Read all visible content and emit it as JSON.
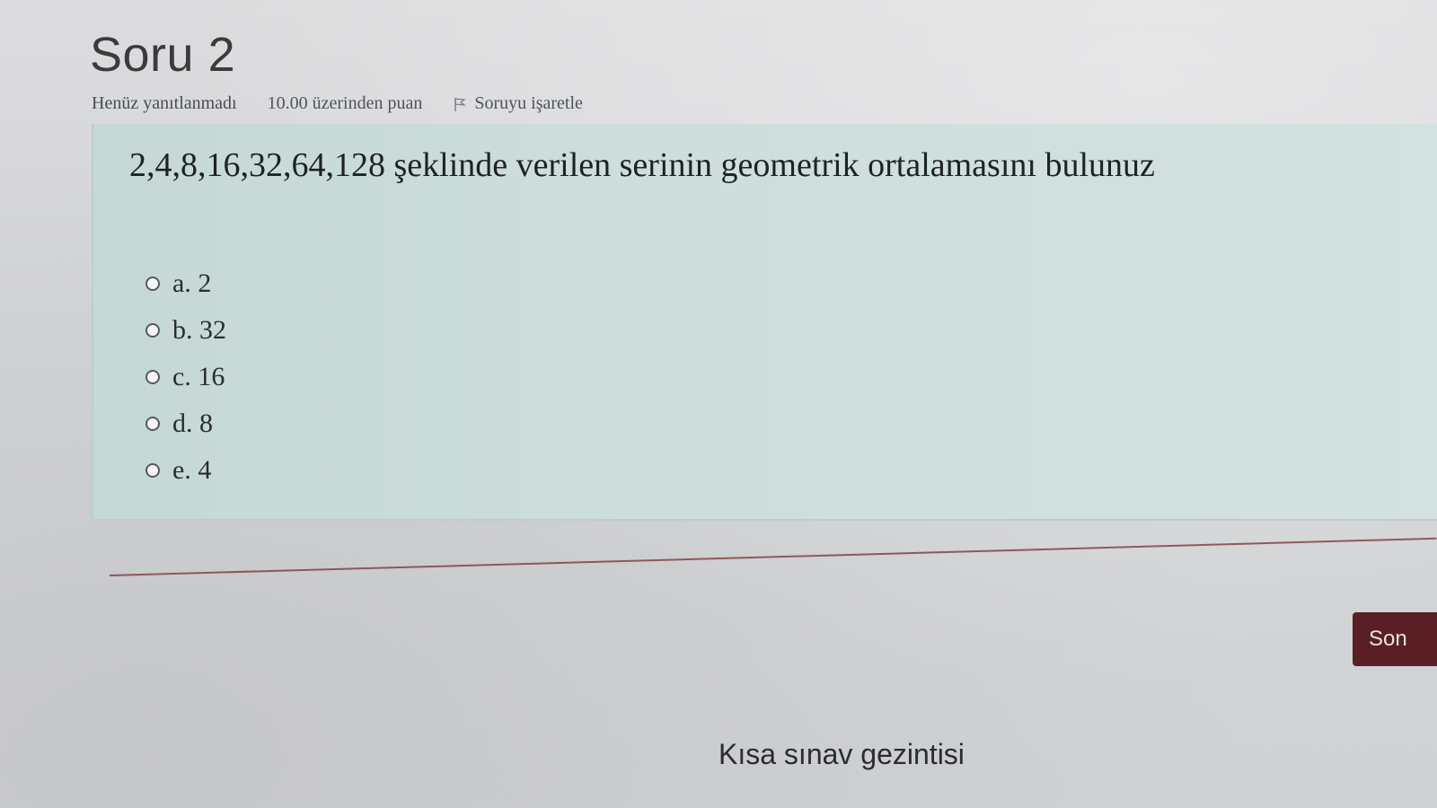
{
  "question": {
    "title": "Soru 2",
    "state": "Henüz yanıtlanmadı",
    "grade": "10.00 üzerinden puan",
    "flag_label": "Soruyu işaretle",
    "text": "2,4,8,16,32,64,128 şeklinde verilen serinin geometrik ortalamasını bulunuz",
    "answers": [
      {
        "label": "a. 2"
      },
      {
        "label": "b. 32"
      },
      {
        "label": "c. 16"
      },
      {
        "label": "d. 8"
      },
      {
        "label": "e. 4"
      }
    ]
  },
  "navigation": {
    "next_button_label": "Son",
    "quiz_navigation_title": "Kısa sınav gezintisi"
  },
  "colors": {
    "formulation_bg": "#cddedc",
    "next_button_bg": "#5a1f25",
    "divider": "#7d3a3f"
  }
}
